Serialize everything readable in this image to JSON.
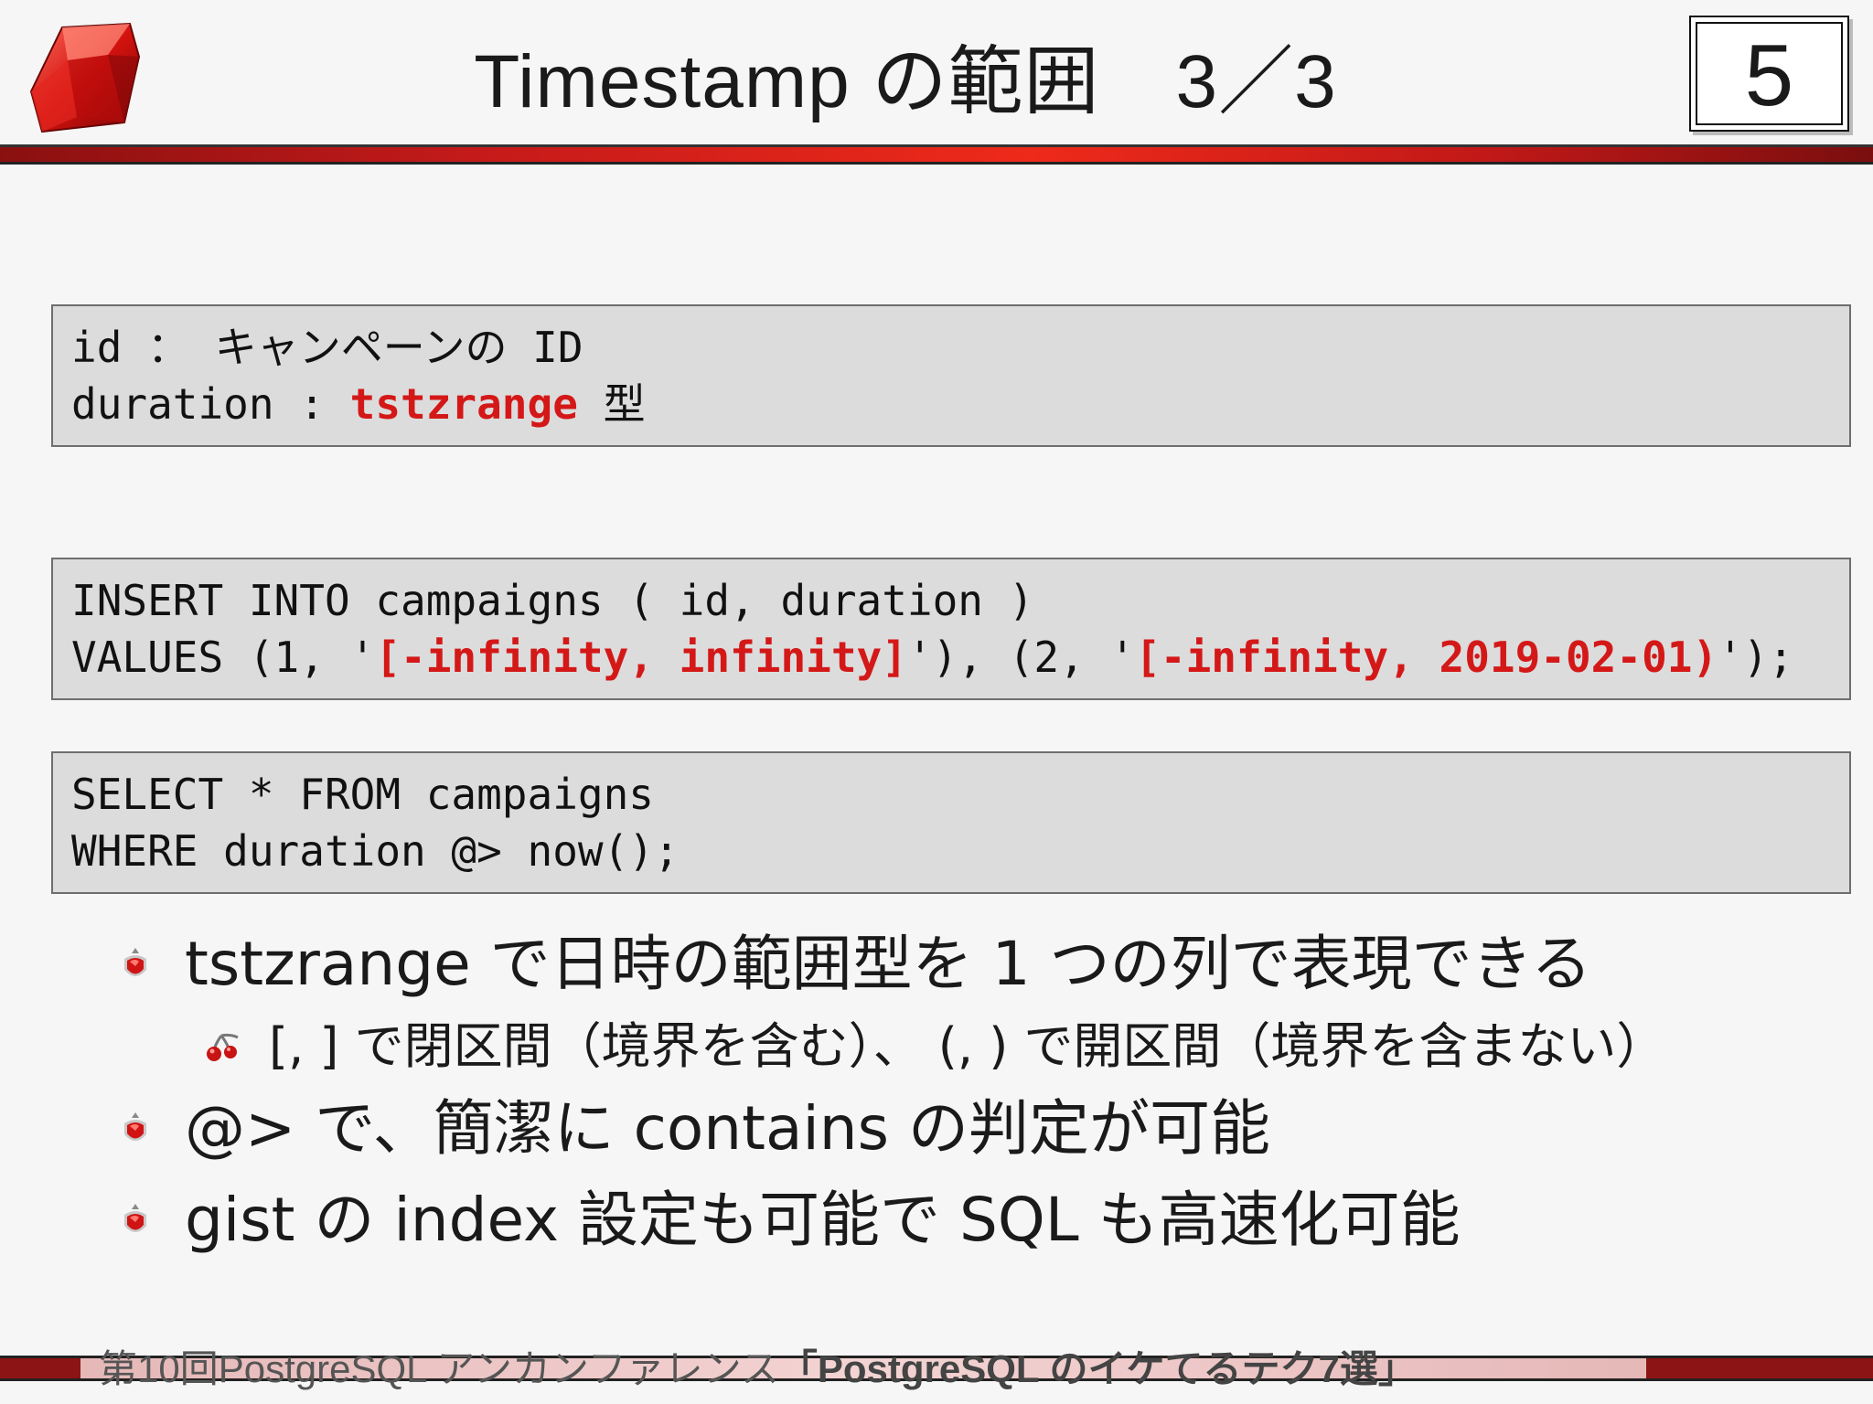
{
  "slide": {
    "title": "Timestamp の範囲　3／3",
    "page_number": "5"
  },
  "code_blocks": {
    "schema": {
      "line1": "id ： キャンペーンの ID",
      "line2_prefix": "duration : ",
      "line2_type": "tstzrange",
      "line2_suffix": " 型"
    },
    "insert": {
      "line1": "INSERT INTO campaigns ( id, duration )",
      "line2_a": "VALUES (1, '",
      "line2_b": "[-infinity, infinity]",
      "line2_c": "'), (2, '",
      "line2_d": "[-infinity, 2019-02-01)",
      "line2_e": "');"
    },
    "select": {
      "line1": "SELECT * FROM campaigns",
      "line2": "WHERE duration @> now();"
    }
  },
  "bullets": [
    "tstzrange で日時の範囲型を 1 つの列で表現できる",
    "[, ] で閉区間（境界を含む）、 (, ) で開区間（境界を含まない）",
    "@> で、簡潔に contains の判定が可能",
    "gist の index 設定も可能で SQL も高速化可能"
  ],
  "footer": {
    "event": "第10回PostgreSQL アンカンファレンス",
    "talk": "「PostgreSQL のイケてるテク7選」"
  },
  "colors": {
    "accent_red": "#d41818",
    "header_bar": "#e02a1a",
    "code_bg": "#dcdcdc"
  },
  "icons": {
    "logo": "ruby-logo-icon",
    "bullet": "ruby-gem-bullet-icon",
    "sub_bullet": "cherry-bullet-icon"
  }
}
